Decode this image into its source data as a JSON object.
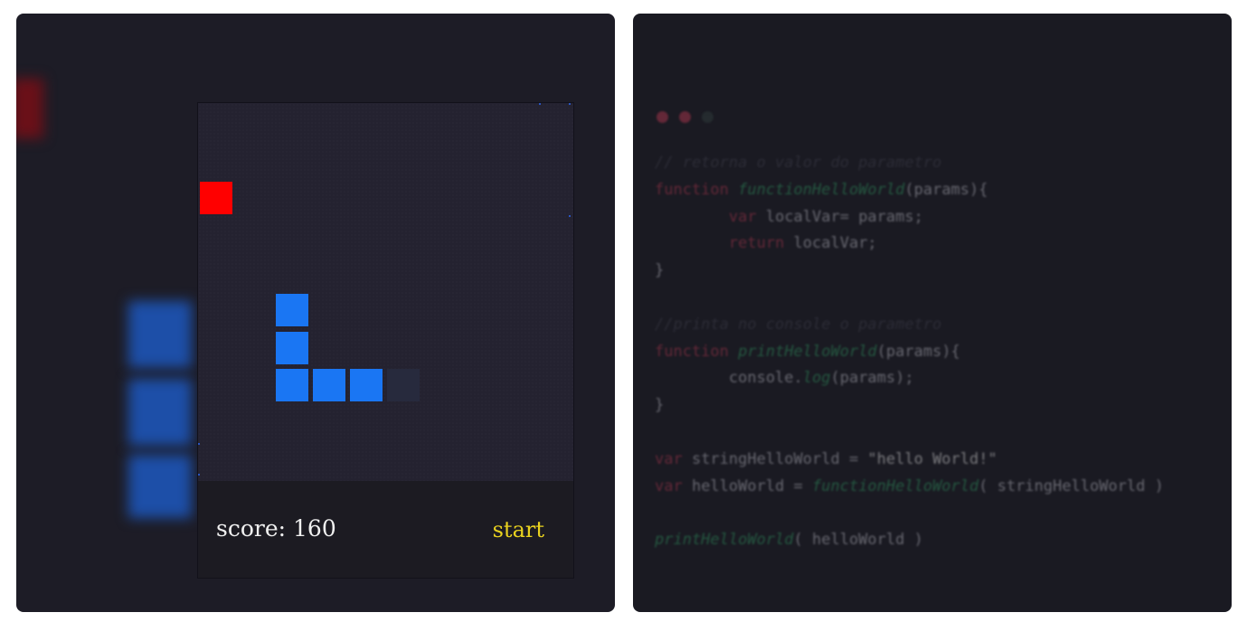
{
  "game": {
    "score_label": "score:",
    "score_value": "160",
    "start_label": "start"
  },
  "colors": {
    "snake": "#1a76f3",
    "food": "#ff0000",
    "start": "#e9d21f"
  },
  "editor": {
    "window_dots": [
      "#a0344a",
      "#a0344a",
      "#2e3a3a"
    ],
    "lines": [
      "// retorna o valor do parametro",
      "function functionHelloWorld(params){",
      "        var localVar= params;",
      "        return localVar;",
      "}",
      "",
      "//printa no console o parametro",
      "function printHelloWorld(params){",
      "        console.log(params);",
      "}",
      "",
      "var stringHelloWorld = \"hello World!\"",
      "var helloWorld = functionHelloWorld( stringHelloWorld )",
      "",
      "printHelloWorld( helloWorld )"
    ]
  }
}
